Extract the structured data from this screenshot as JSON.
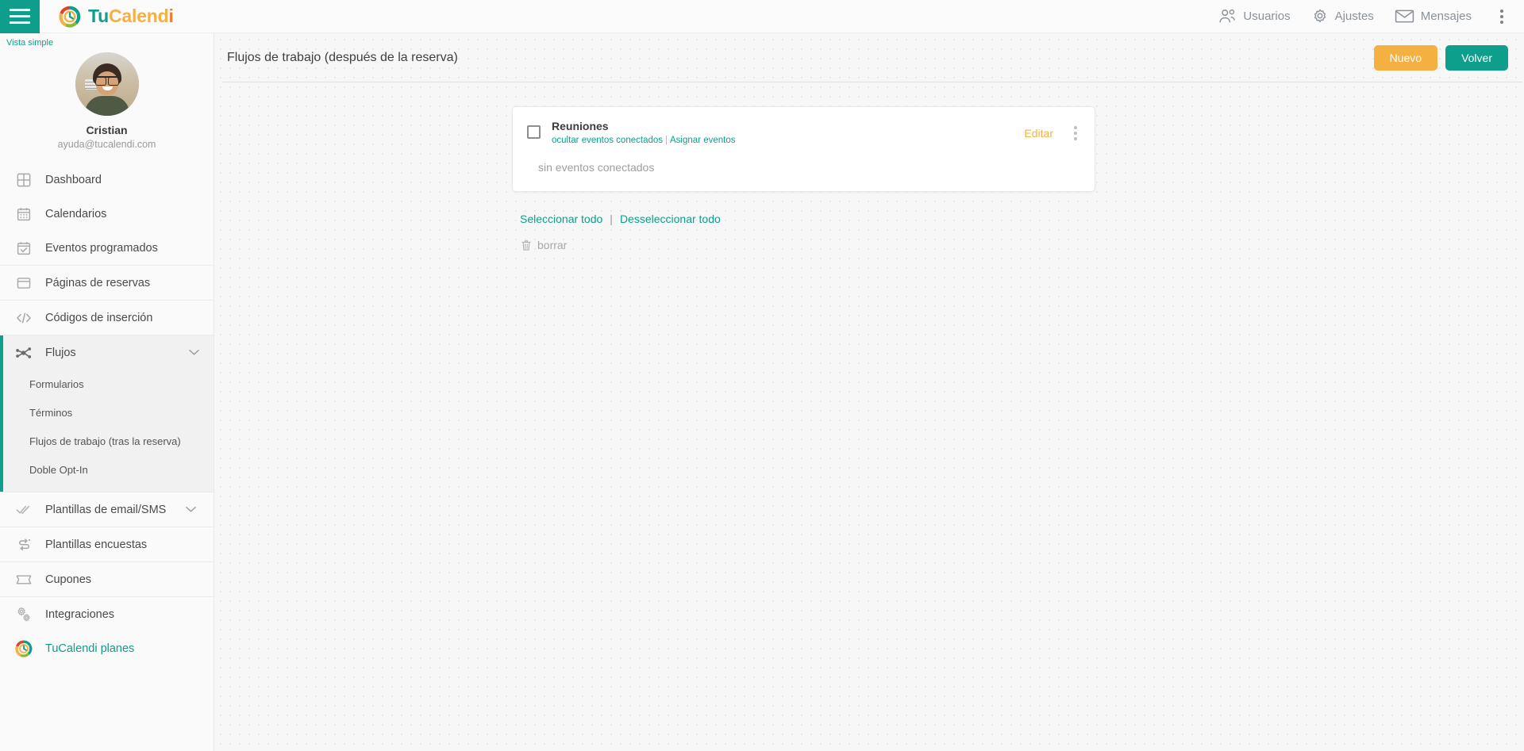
{
  "topbar": {
    "menu_icon": "hamburger-icon",
    "brand": {
      "part1": "Tu",
      "part2": "Calend",
      "part3": "i"
    },
    "items": [
      {
        "label": "Usuarios",
        "icon": "users-icon"
      },
      {
        "label": "Ajustes",
        "icon": "gear-icon"
      },
      {
        "label": "Mensajes",
        "icon": "envelope-icon"
      }
    ],
    "overflow_icon": "vertical-dots-icon"
  },
  "sidebar": {
    "vista_simple": "Vista simple",
    "profile": {
      "name": "Cristian",
      "email": "ayuda@tucalendi.com",
      "avatar": "user-avatar"
    },
    "items": [
      {
        "label": "Dashboard",
        "icon": "grid-icon"
      },
      {
        "label": "Calendarios",
        "icon": "calendar-icon"
      },
      {
        "label": "Eventos programados",
        "icon": "calendar-check-icon"
      },
      {
        "label": "Páginas de reservas",
        "icon": "window-icon"
      },
      {
        "label": "Códigos de inserción",
        "icon": "code-icon"
      },
      {
        "label": "Flujos",
        "icon": "flow-node-icon"
      },
      {
        "label": "Plantillas de email/SMS",
        "icon": "double-check-icon"
      },
      {
        "label": "Plantillas encuestas",
        "icon": "survey-icon"
      },
      {
        "label": "Cupones",
        "icon": "ticket-icon"
      },
      {
        "label": "Integraciones",
        "icon": "gears-icon"
      },
      {
        "label": "TuCalendi planes",
        "icon": "tucalendi-logo-icon"
      }
    ],
    "flujos_sub": [
      {
        "label": "Formularios"
      },
      {
        "label": "Términos"
      },
      {
        "label": "Flujos de trabajo (tras la reserva)"
      },
      {
        "label": "Doble Opt-In"
      }
    ]
  },
  "main": {
    "page_title": "Flujos de trabajo (después de la reserva)",
    "new_button": "Nuevo",
    "back_button": "Volver",
    "card": {
      "title": "Reuniones",
      "link_hide": "ocultar eventos conectados",
      "link_sep": "|",
      "link_assign": "Asignar eventos",
      "edit_label": "Editar",
      "empty_text": "sin eventos conectados",
      "menu_icon": "vertical-dots-icon",
      "checkbox_checked": false
    },
    "select_all": "Seleccionar todo",
    "select_sep": "|",
    "deselect_all": "Desseleccionar todo",
    "delete_label": "borrar",
    "delete_icon": "trash-icon"
  },
  "colors": {
    "teal": "#0d9e8c",
    "amber": "#f5b042",
    "orange": "#f07c30",
    "green": "#8ab734",
    "red": "#e0452b",
    "text": "#4a4a4a",
    "muted": "#9e9e9e"
  }
}
